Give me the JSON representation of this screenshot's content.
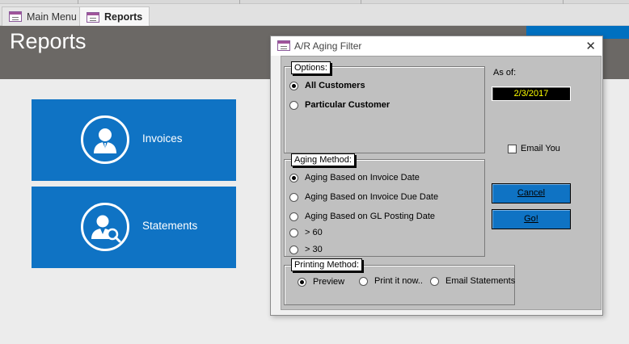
{
  "tabs": [
    {
      "label": "Main Menu",
      "active": false
    },
    {
      "label": "Reports",
      "active": true
    }
  ],
  "header": {
    "title": "Reports"
  },
  "report_buttons": [
    {
      "label": "Invoices",
      "icon": "user-icon"
    },
    {
      "label": "Statements",
      "icon": "user-search-icon"
    }
  ],
  "dialog": {
    "title": "A/R Aging Filter",
    "options": {
      "label": "Options:",
      "items": [
        {
          "label": "All Customers",
          "selected": true
        },
        {
          "label": "Particular Customer",
          "selected": false
        }
      ]
    },
    "aging_method": {
      "label": "Aging Method:",
      "items": [
        {
          "label": "Aging Based on Invoice Date",
          "selected": true
        },
        {
          "label": "Aging Based on Invoice Due Date",
          "selected": false
        },
        {
          "label": "Aging Based on GL Posting Date",
          "selected": false
        },
        {
          "label": "> 60",
          "selected": false
        },
        {
          "label": "> 30",
          "selected": false
        }
      ]
    },
    "printing_method": {
      "label": "Printing Method:",
      "items": [
        {
          "label": "Preview",
          "selected": true
        },
        {
          "label": "Print it now..",
          "selected": false
        },
        {
          "label": "Email Statements",
          "selected": false
        }
      ]
    },
    "as_of": {
      "label": "As of:",
      "value": "2/3/2017"
    },
    "email_you": {
      "label": "Email You",
      "checked": false
    },
    "cancel_label": "Cancel",
    "go_label": "Go!"
  },
  "colors": {
    "accent": "#0f73c4",
    "header": "#6b6865",
    "dialog_body": "#c0c0c0"
  }
}
